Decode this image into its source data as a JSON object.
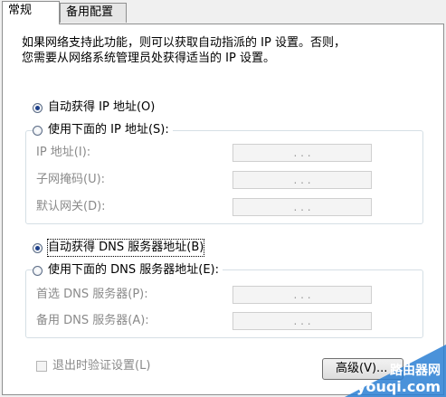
{
  "tabs": [
    {
      "label": "常规",
      "active": true
    },
    {
      "label": "备用配置",
      "active": false
    }
  ],
  "description": {
    "line1": "如果网络支持此功能，则可以获取自动指派的 IP 设置。否则，",
    "line2": "您需要从网络系统管理员处获得适当的 IP 设置。"
  },
  "ip": {
    "auto_label": "自动获得 IP 地址(O)",
    "auto_checked": true,
    "manual_label": "使用下面的 IP 地址(S):",
    "manual_checked": false,
    "fields": [
      {
        "label": "IP 地址(I):",
        "value": ". . ."
      },
      {
        "label": "子网掩码(U):",
        "value": ". . ."
      },
      {
        "label": "默认网关(D):",
        "value": ". . ."
      }
    ]
  },
  "dns": {
    "auto_label": "自动获得 DNS 服务器地址(B)",
    "auto_checked": true,
    "manual_label": "使用下面的 DNS 服务器地址(E):",
    "manual_checked": false,
    "fields": [
      {
        "label": "首选 DNS 服务器(P):",
        "value": ". . ."
      },
      {
        "label": "备用 DNS 服务器(A):",
        "value": ". . ."
      }
    ]
  },
  "validate_label": "退出时验证设置(L)",
  "advanced_label": "高级(V)...",
  "watermark": {
    "top": "路由器网",
    "bottom": "luyouqi.com"
  },
  "colors": {
    "radio_dot": "#1c3f8a",
    "watermark_blue": "#2a7fd4"
  }
}
